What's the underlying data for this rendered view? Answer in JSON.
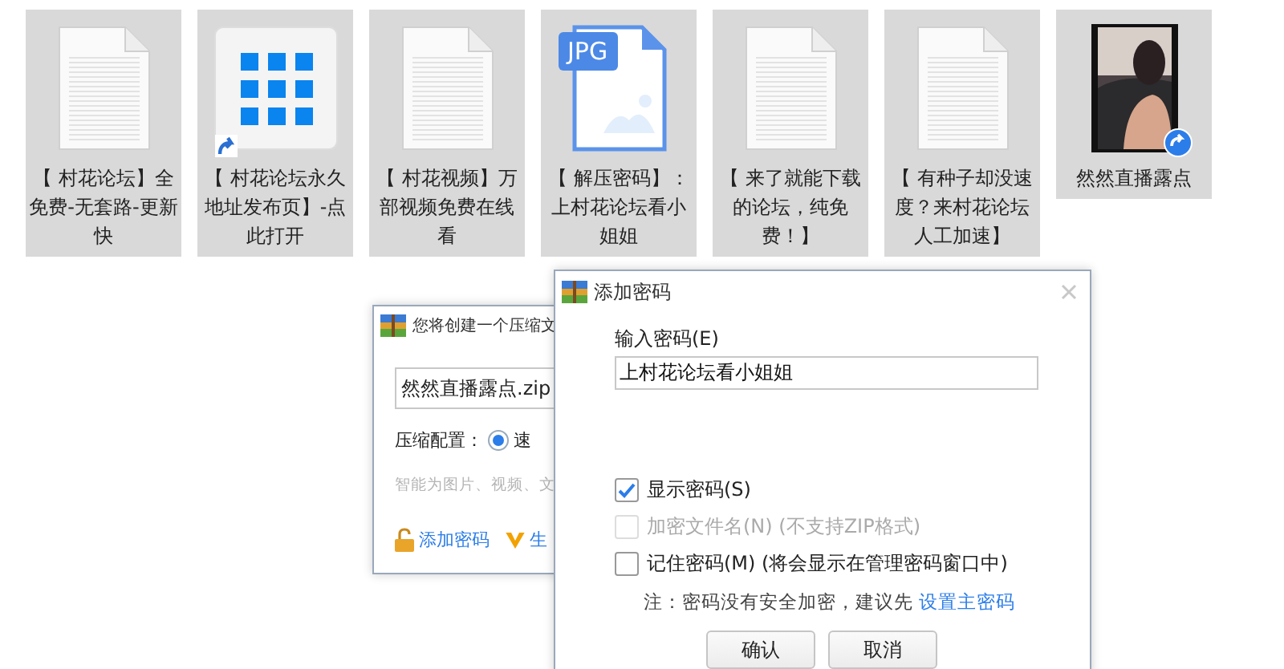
{
  "files": [
    {
      "kind": "document",
      "name": "【 村花论坛】全免费-无套路-更新快"
    },
    {
      "kind": "app_shortcut",
      "name": "【 村花论坛永久地址发布页】-点此打开"
    },
    {
      "kind": "document",
      "name": "【 村花视频】万部视频免费在线看"
    },
    {
      "kind": "jpg",
      "badge": "JPG",
      "name": "【 解压密码】：上村花论坛看小姐姐"
    },
    {
      "kind": "document",
      "name": "【 来了就能下载的论坛，纯免费！】"
    },
    {
      "kind": "document",
      "name": "【 有种子却没速度？来村花论坛人工加速】"
    },
    {
      "kind": "video",
      "name": "然然直播露点"
    }
  ],
  "create_dialog": {
    "title": "您将创建一个压缩文",
    "filename": "然然直播露点.zip",
    "config_label": "压缩配置：",
    "config_option": {
      "label": "速",
      "selected": true
    },
    "hint": "智能为图片、视频、文",
    "add_password_link": "添加密码",
    "second_link": "生"
  },
  "password_dialog": {
    "title": "添加密码",
    "field_label": "输入密码(E)",
    "password": "上村花论坛看小姐姐",
    "options": [
      {
        "label": "显示密码(S)",
        "checked": true,
        "disabled": false
      },
      {
        "label": "加密文件名(N) (不支持ZIP格式)",
        "checked": false,
        "disabled": true
      },
      {
        "label": "记住密码(M) (将会显示在管理密码窗口中)",
        "checked": false,
        "disabled": false
      }
    ],
    "note": "注：密码没有安全加密，建议先",
    "note_link": "设置主密码",
    "buttons": [
      "确认",
      "取消"
    ]
  }
}
